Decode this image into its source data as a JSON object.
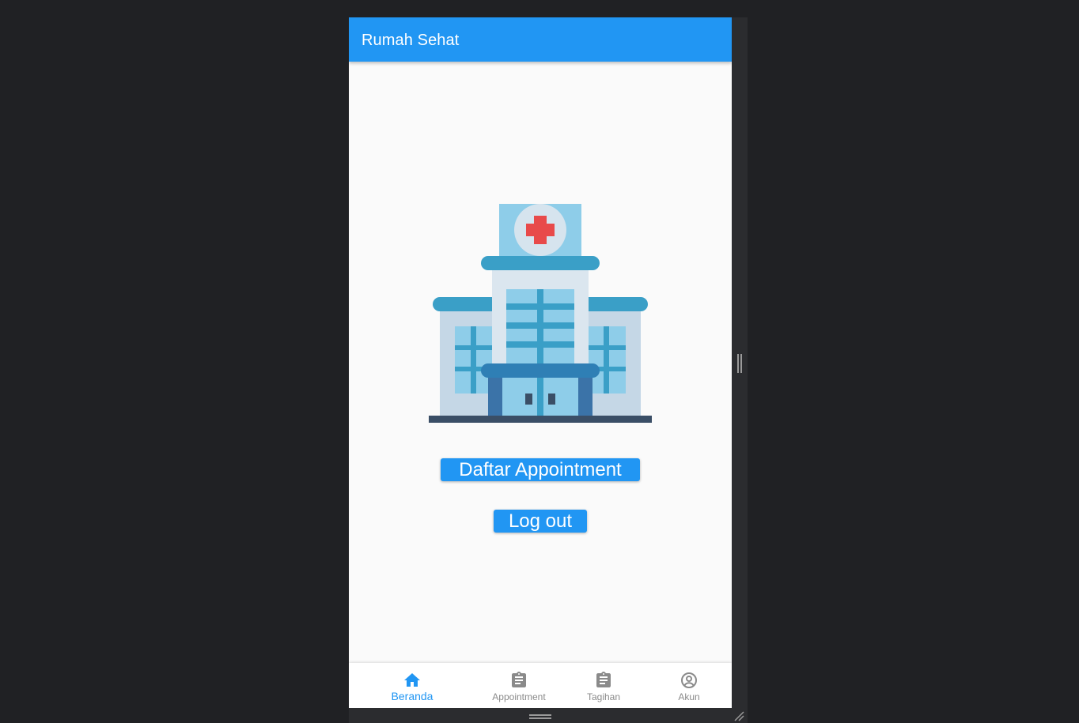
{
  "app_bar": {
    "title": "Rumah Sehat"
  },
  "illustration": {
    "icon": "hospital-building-illustration"
  },
  "actions": {
    "daftar_appointment_label": "Daftar Appointment",
    "logout_label": "Log out"
  },
  "bottom_nav": {
    "items": [
      {
        "label": "Beranda",
        "icon": "home-icon",
        "active": true
      },
      {
        "label": "Appointment",
        "icon": "clipboard-icon",
        "active": false
      },
      {
        "label": "Tagihan",
        "icon": "clipboard-icon",
        "active": false
      },
      {
        "label": "Akun",
        "icon": "account-circle-icon",
        "active": false
      }
    ]
  },
  "colors": {
    "primary": "#2196f3",
    "background": "#fafafa",
    "outer_background": "#202124",
    "inactive_nav": "#8a8a8a"
  }
}
